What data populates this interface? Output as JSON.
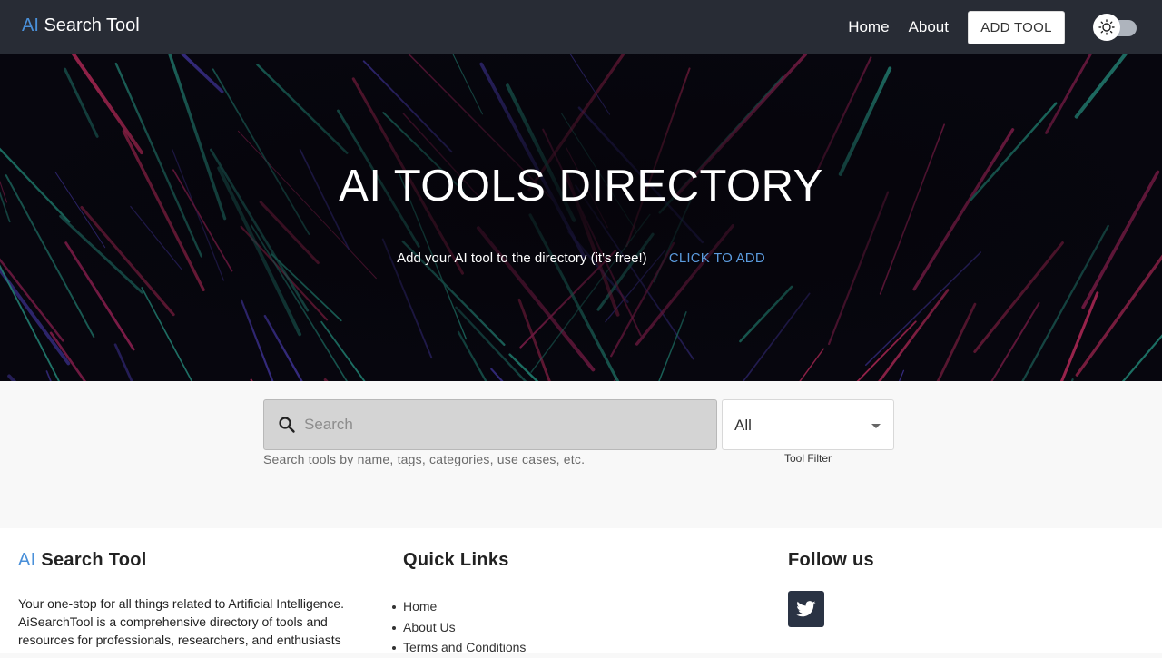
{
  "navbar": {
    "brand_prefix": "AI",
    "brand_suffix": " Search Tool",
    "links": [
      {
        "label": "Home"
      },
      {
        "label": "About"
      }
    ],
    "add_tool_label": "ADD TOOL",
    "theme_toggle_icon": "sun-icon"
  },
  "hero": {
    "title": "AI TOOLS DIRECTORY",
    "subtitle": "Add your AI tool to the directory (it's free!)",
    "cta_label": "CLICK TO ADD"
  },
  "search": {
    "icon": "search-icon",
    "value": "",
    "placeholder": "Search",
    "helper_text": "Search tools by name, tags, categories, use cases, etc.",
    "filter_value": "All",
    "filter_label": "Tool Filter"
  },
  "footer": {
    "brand_prefix": "AI",
    "brand_suffix": " Search Tool",
    "description": "Your one-stop for all things related to Artificial Intelligence. AiSearchTool is a comprehensive directory of tools and resources for professionals, researchers, and enthusiasts",
    "quick_links_title": "Quick Links",
    "quick_links": [
      {
        "label": "Home"
      },
      {
        "label": "About Us"
      },
      {
        "label": "Terms and Conditions"
      }
    ],
    "follow_title": "Follow us",
    "social": [
      {
        "icon": "twitter-icon"
      }
    ]
  },
  "colors": {
    "navbar_bg": "#282c35",
    "accent_blue": "#4a90d9",
    "cta_blue": "#5b9bde",
    "hero_bg": "#07060e",
    "social_btn_bg": "#2a3344"
  }
}
